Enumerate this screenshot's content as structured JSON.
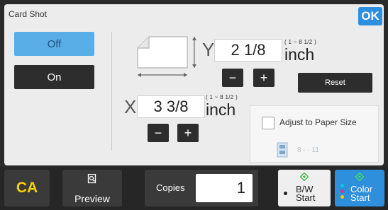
{
  "header": {
    "title": "Card Shot",
    "ok_label": "OK"
  },
  "mode": {
    "off_label": "Off",
    "on_label": "On",
    "selected": "Off"
  },
  "y_axis": {
    "letter": "Y",
    "value": "2 1/8",
    "range": "( 1 ~ 8 1/2 )",
    "unit": "inch",
    "minus": "−",
    "plus": "+"
  },
  "x_axis": {
    "letter": "X",
    "value": "3 3/8",
    "range": "( 1 ~ 8 1/2 )",
    "unit": "inch",
    "minus": "−",
    "plus": "+"
  },
  "reset_label": "Reset",
  "adjust": {
    "label": "Adjust to Paper Size",
    "checked": false,
    "paper_size": "8 · · 11"
  },
  "bottom": {
    "ca_label": "CA",
    "preview_label": "Preview",
    "copies_label": "Copies",
    "copies_value": "1",
    "bw_label_line1": "B/W",
    "bw_label_line2": "Start",
    "color_label_line1": "Color",
    "color_label_line2": "Start"
  },
  "colors": {
    "accent": "#2e8fdc",
    "selected_mode": "#5aaee8",
    "ca": "#f3d000",
    "start_icon": "#41b649"
  }
}
